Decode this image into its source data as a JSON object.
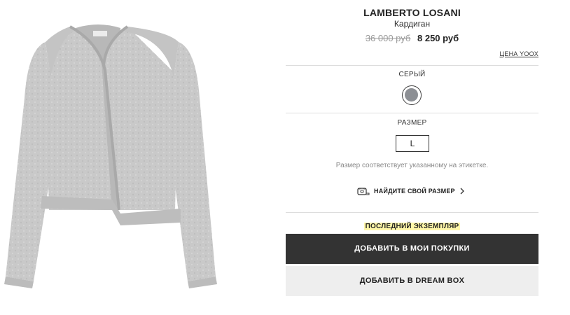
{
  "product": {
    "brand": "LAMBERTO LOSANI",
    "category": "Кардиган",
    "old_price": "36 000 руб",
    "new_price": "8 250 руб",
    "price_link": "ЦЕНА YOOX",
    "image_alt_icon": "cardigan-image"
  },
  "color": {
    "label": "СЕРЫЙ",
    "swatch_hex": "#8c8f94"
  },
  "size": {
    "label": "РАЗМЕР",
    "selected": "L",
    "note": "Размер соответствует указанному на этикетке.",
    "find_size_label": "НАЙДИТЕ СВОЙ РАЗМЕР",
    "find_size_icon": "measuring-tape-icon"
  },
  "availability": {
    "last_item": "ПОСЛЕДНИЙ ЭКЗЕМПЛЯР",
    "highlight_hex": "#fff7a8"
  },
  "actions": {
    "add_to_cart": "ДОБАВИТЬ В МОИ ПОКУПКИ",
    "add_to_dreambox": "ДОБАВИТЬ В DREAM BOX"
  }
}
